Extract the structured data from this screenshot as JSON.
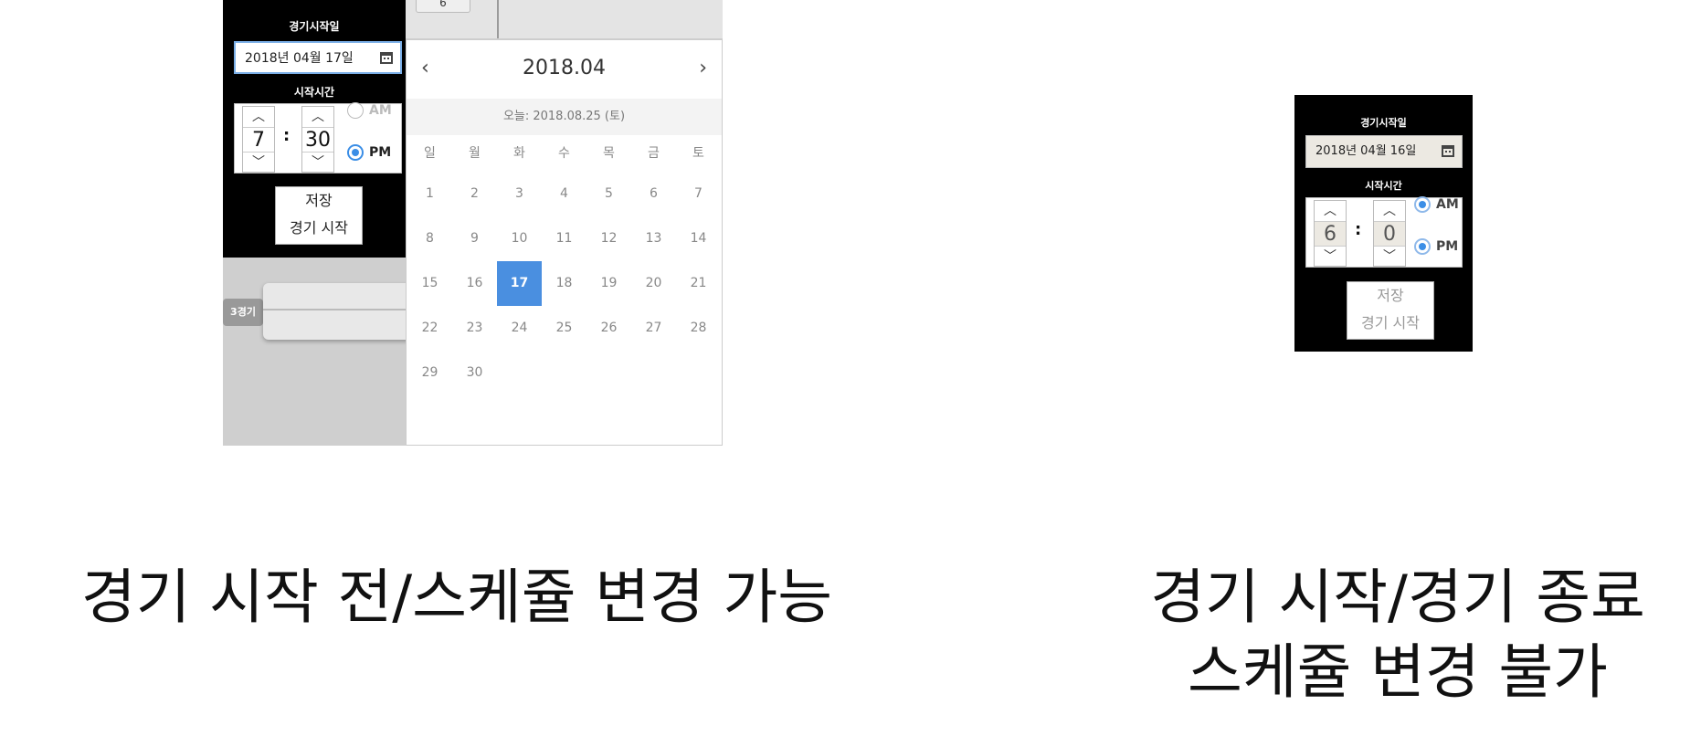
{
  "left": {
    "top_card_label": "6",
    "panel": {
      "start_date_label": "경기시작일",
      "date_value": "2018년 04월 17일",
      "start_time_label": "시작시간",
      "hour": "7",
      "minute": "30",
      "colon": ":",
      "up_arrow": "︿",
      "down_arrow": "﹀",
      "am_label": "AM",
      "pm_label": "PM",
      "selected_period": "PM",
      "save_label": "저장",
      "start_game_label": "경기 시작"
    },
    "game_tag": "3경기",
    "calendar": {
      "title": "2018.04",
      "prev": "‹",
      "next": "›",
      "today": "오늘: 2018.08.25 (토)",
      "weekdays": [
        "일",
        "월",
        "화",
        "수",
        "목",
        "금",
        "토"
      ],
      "days": [
        "1",
        "2",
        "3",
        "4",
        "5",
        "6",
        "7",
        "8",
        "9",
        "10",
        "11",
        "12",
        "13",
        "14",
        "15",
        "16",
        "17",
        "18",
        "19",
        "20",
        "21",
        "22",
        "23",
        "24",
        "25",
        "26",
        "27",
        "28",
        "29",
        "30"
      ],
      "selected_day": "17",
      "accent_color": "#4a8fe0"
    }
  },
  "right": {
    "panel": {
      "start_date_label": "경기시작일",
      "date_value": "2018년 04월 16일",
      "start_time_label": "시작시간",
      "hour": "6",
      "minute": "0",
      "colon": ":",
      "up_arrow": "︿",
      "down_arrow": "﹀",
      "am_label": "AM",
      "pm_label": "PM",
      "save_label": "저장",
      "start_game_label": "경기 시작"
    }
  },
  "captions": {
    "left": "경기 시작 전/스케쥴 변경 가능",
    "right_line1": "경기 시작/경기 종료",
    "right_line2": "스케쥴 변경 불가"
  }
}
